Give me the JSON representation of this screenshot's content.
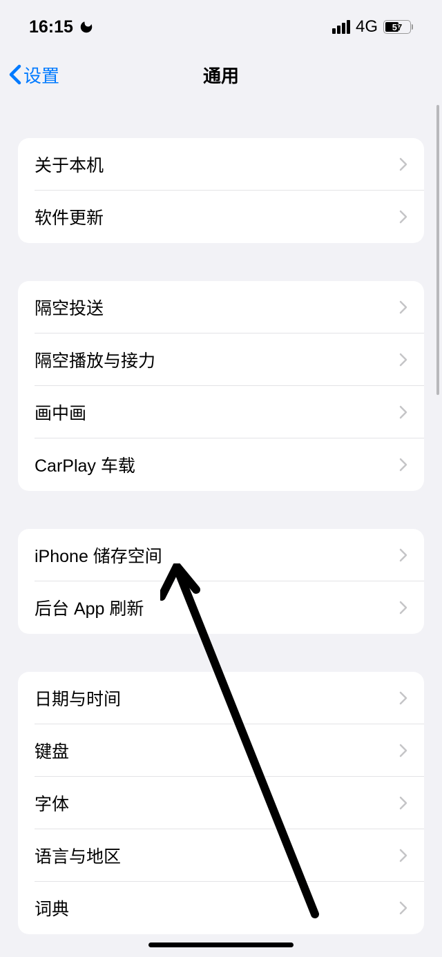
{
  "status": {
    "time": "16:15",
    "network": "4G",
    "battery_percent": "57"
  },
  "nav": {
    "back_label": "设置",
    "title": "通用"
  },
  "sections": [
    {
      "rows": [
        {
          "id": "about",
          "label": "关于本机"
        },
        {
          "id": "software-update",
          "label": "软件更新"
        }
      ]
    },
    {
      "rows": [
        {
          "id": "airdrop",
          "label": "隔空投送"
        },
        {
          "id": "airplay-handoff",
          "label": "隔空播放与接力"
        },
        {
          "id": "pip",
          "label": "画中画"
        },
        {
          "id": "carplay",
          "label": "CarPlay 车载"
        }
      ]
    },
    {
      "rows": [
        {
          "id": "iphone-storage",
          "label": "iPhone 储存空间"
        },
        {
          "id": "background-app-refresh",
          "label": "后台 App 刷新"
        }
      ]
    },
    {
      "rows": [
        {
          "id": "date-time",
          "label": "日期与时间"
        },
        {
          "id": "keyboard",
          "label": "键盘"
        },
        {
          "id": "fonts",
          "label": "字体"
        },
        {
          "id": "language-region",
          "label": "语言与地区"
        },
        {
          "id": "dictionary",
          "label": "词典"
        }
      ]
    }
  ]
}
